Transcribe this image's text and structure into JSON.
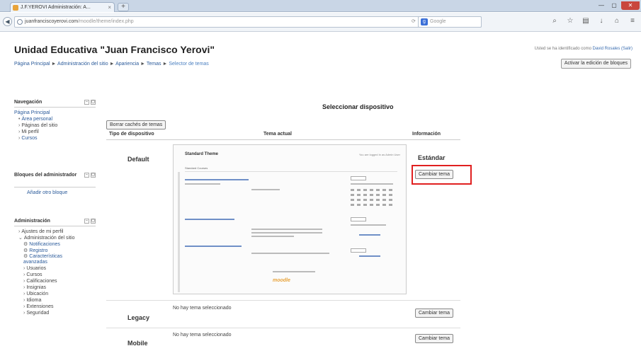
{
  "browser": {
    "tab_title": "J.F.YEROVI Administración: A...",
    "url_host": "juanfranciscoyerovi.com",
    "url_path": "/moodle/theme/index.php",
    "search_placeholder": "Google",
    "search_engine_glyph": "g",
    "icons": [
      "back-arrow-icon",
      "globe-icon",
      "reload-icon",
      "search-icon",
      "home-icon",
      "star-icon",
      "download-icon",
      "bookmark-icon",
      "menu-icon"
    ]
  },
  "header": {
    "site_title": "Unidad Educativa \"Juan Francisco Yerovi\"",
    "login_prefix": "Usted se ha identificado como",
    "login_user": "David Rosales (Salir)",
    "edit_blocks_button": "Activar la edición de bloques"
  },
  "breadcrumb": {
    "items": [
      "Página Principal",
      "Administración del sitio",
      "Apariencia",
      "Temas",
      "Selector de temas"
    ],
    "separator": "►"
  },
  "sidebar": {
    "navigation": {
      "title": "Navegación",
      "items": [
        "Página Principal",
        "Área personal",
        "Páginas del sitio",
        "Mi perfil",
        "Cursos"
      ]
    },
    "admin_blocks": {
      "title": "Bloques del administrador",
      "link": "Añadir otro bloque"
    },
    "administration": {
      "title": "Administración",
      "items": [
        "Ajustes de mi perfil",
        "Administración del sitio",
        "Notificaciones",
        "Registro",
        "Características avanzadas",
        "Usuarios",
        "Cursos",
        "Calificaciones",
        "Insignias",
        "Ubicación",
        "Idioma",
        "Extensiones",
        "Seguridad"
      ]
    }
  },
  "main": {
    "heading": "Seleccionar dispositivo",
    "reset_button": "Borrar cachés de temas",
    "columns": [
      "Tipo de dispositivo",
      "Tema actual",
      "Información"
    ],
    "rows": [
      {
        "device": "Default",
        "theme": "Estándar",
        "button": "Cambiar tema"
      },
      {
        "device": "Legacy",
        "theme": "No hay tema seleccionado",
        "button": "Cambiar tema"
      },
      {
        "device": "Mobile",
        "theme": "No hay tema seleccionado",
        "button": "Cambiar tema"
      }
    ]
  },
  "preview": {
    "title": "Standard Theme",
    "login": "You are logged in as Admin User",
    "crumb": "Standard Courses",
    "logo": "moodle"
  },
  "colors": {
    "link": "#2a5a9a",
    "highlight": "#e02020"
  }
}
